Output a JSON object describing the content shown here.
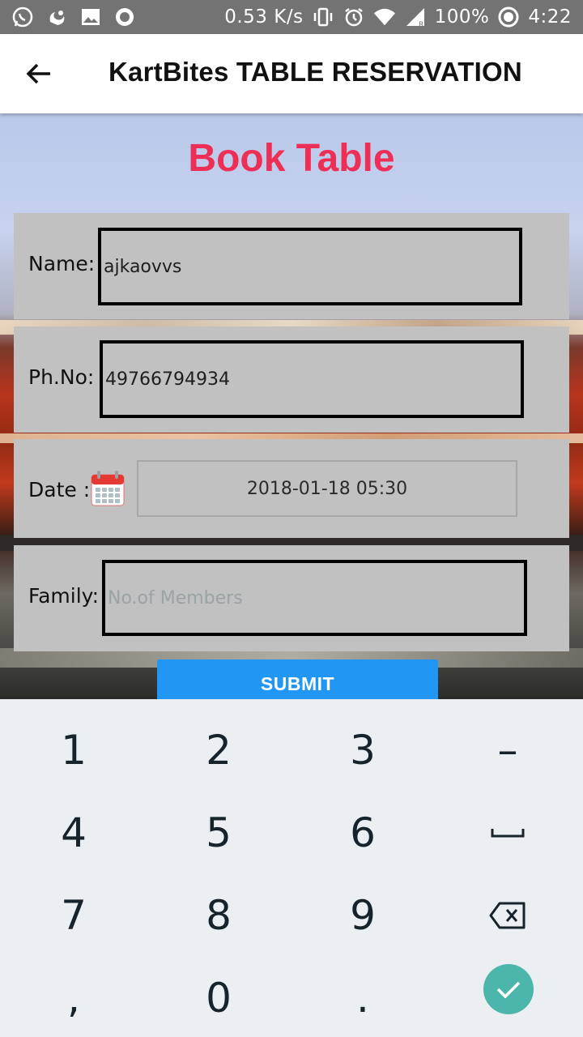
{
  "status_bar": {
    "speed": "0.53 K/s",
    "battery": "100%",
    "time": "4:22",
    "left_icons": [
      "whatsapp-icon",
      "uc-browser-icon",
      "image-icon",
      "record-icon"
    ],
    "right_icons": [
      "vibrate-icon",
      "alarm-icon",
      "wifi-icon",
      "signal-icon",
      "battery-circle-icon"
    ]
  },
  "app_bar": {
    "title": "KartBites TABLE RESERVATION",
    "back_icon": "arrow-left-icon"
  },
  "form": {
    "heading": "Book Table",
    "name": {
      "label": "Name:",
      "value": "ajkaovvs"
    },
    "phone": {
      "label": "Ph.No:",
      "value": "49766794934"
    },
    "date": {
      "label": "Date :",
      "value": "2018-01-18 05:30",
      "icon": "calendar-icon"
    },
    "family": {
      "label": "Family:",
      "placeholder": "No.of Members"
    },
    "submit_label": "SUBMIT"
  },
  "colors": {
    "heading": "#ee2f55",
    "submit": "#2196f3",
    "done_key": "#4db6ac",
    "status_bar": "#737373"
  },
  "keyboard": {
    "keys": [
      "1",
      "2",
      "3",
      "–",
      "4",
      "5",
      "6",
      "space",
      "7",
      "8",
      "9",
      "backspace",
      ",",
      "0",
      ".",
      "done"
    ]
  }
}
